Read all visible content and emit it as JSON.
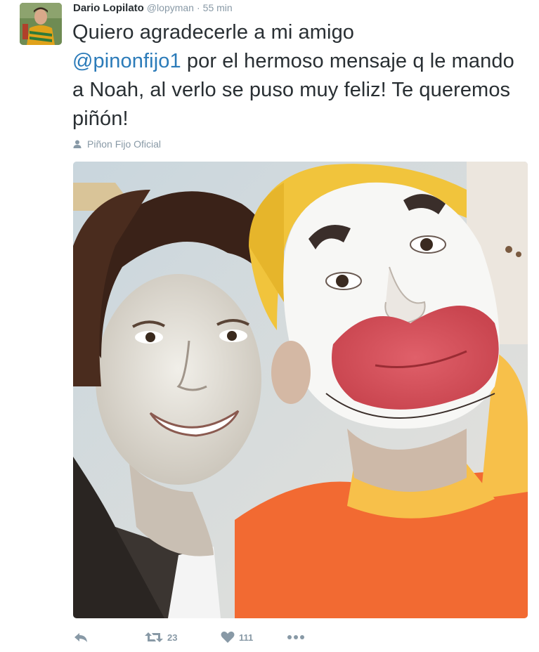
{
  "tweet": {
    "author": {
      "full_name": "Dario Lopilato",
      "screen_name": "@lopyman",
      "avatar_icon": "profile-photo"
    },
    "separator": "·",
    "time": "55 min",
    "text": {
      "line1": "Quiero agradecerle a mi amigo",
      "mention": "@pinonfijo1",
      "after_mention": " por el hermoso mensaje q le mando a Noah, al verlo se puso muy feliz! Te queremos piñón!"
    },
    "tagged": {
      "icon": "person-icon",
      "name": "Piñon Fijo Oficial"
    },
    "media": {
      "type": "photo",
      "description_icon": "photo"
    },
    "actions": {
      "reply_icon": "reply-icon",
      "retweet_icon": "retweet-icon",
      "retweet_count": "23",
      "like_icon": "heart-icon",
      "like_count": "111",
      "more_icon": "more-dots-icon"
    },
    "colors": {
      "link": "#2b7bb9",
      "secondary_text": "#8899a6",
      "primary_text": "#292f33"
    }
  }
}
